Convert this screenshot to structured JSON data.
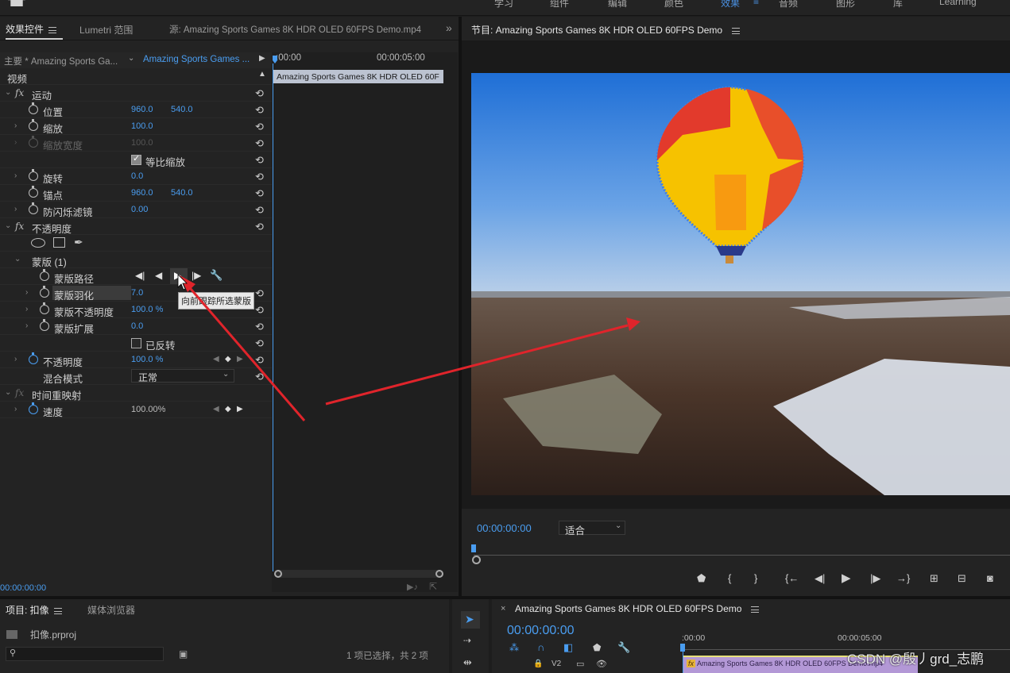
{
  "workspaces": [
    "学习",
    "组件",
    "编辑",
    "颜色",
    "效果",
    "音频",
    "图形",
    "库",
    "Learning"
  ],
  "workspace_active": "效果",
  "left_panel": {
    "tabs": [
      {
        "label": "效果控件",
        "active": true
      },
      {
        "label": "Lumetri 范围",
        "active": false
      },
      {
        "label": "源: Amazing Sports Games 8K HDR OLED 60FPS Demo.mp4",
        "active": false
      }
    ],
    "overflow": "»",
    "master_label": "主要 * Amazing Sports Ga...",
    "clip_label": "Amazing Sports Games ...",
    "ruler_start": ":00:00",
    "ruler_end": "00:00:05:00",
    "clip_bar": "Amazing Sports Games 8K HDR OLED 60F",
    "video_header": "视频",
    "motion": {
      "label": "运动",
      "position": {
        "label": "位置",
        "x": "960.0",
        "y": "540.0"
      },
      "scale": {
        "label": "缩放",
        "value": "100.0"
      },
      "scale_width": {
        "label": "缩放宽度",
        "value": "100.0"
      },
      "uniform_scale": {
        "label": "等比缩放",
        "checked": true
      },
      "rotation": {
        "label": "旋转",
        "value": "0.0"
      },
      "anchor": {
        "label": "锚点",
        "x": "960.0",
        "y": "540.0"
      },
      "anti_flicker": {
        "label": "防闪烁滤镜",
        "value": "0.00"
      }
    },
    "opacity_group": {
      "label": "不透明度",
      "mask": {
        "label": "蒙版 (1)",
        "path": "蒙版路径",
        "feather": {
          "label": "蒙版羽化",
          "value": "7.0"
        },
        "opacity": {
          "label": "蒙版不透明度",
          "value": "100.0 %"
        },
        "expansion": {
          "label": "蒙版扩展",
          "value": "0.0"
        },
        "inverted": {
          "label": "已反转",
          "checked": false
        }
      },
      "opacity": {
        "label": "不透明度",
        "value": "100.0 %"
      },
      "blend": {
        "label": "混合模式",
        "value": "正常"
      }
    },
    "time_remap": {
      "label": "时间重映射",
      "speed_label": "速度",
      "speed_value": "100.00%"
    },
    "tooltip": "向前跟踪所选蒙版",
    "footer_tc": "00:00:00:00"
  },
  "program": {
    "title": "节目: Amazing Sports Games 8K HDR OLED 60FPS Demo",
    "timecode": "00:00:00:00",
    "fit": "适合"
  },
  "project": {
    "tabs": [
      {
        "label": "项目: 扣像",
        "active": true
      },
      {
        "label": "媒体浏览器",
        "active": false
      }
    ],
    "file": "扣像.prproj",
    "selection": "1 项已选择，共 2 项"
  },
  "timeline": {
    "title": "Amazing Sports Games 8K HDR OLED 60FPS Demo",
    "timecode": "00:00:00:00",
    "ruler_start": ":00:00",
    "ruler_end": "00:00:05:00",
    "track": "V2",
    "clip": "Amazing Sports Games 8K HDR OLED 60FPS Demo.mp4"
  },
  "watermark": "CSDN @殷丿grd_志鹏",
  "colors": {
    "accent": "#4a9df0",
    "panel": "#232323",
    "clip": "#b398d6"
  }
}
